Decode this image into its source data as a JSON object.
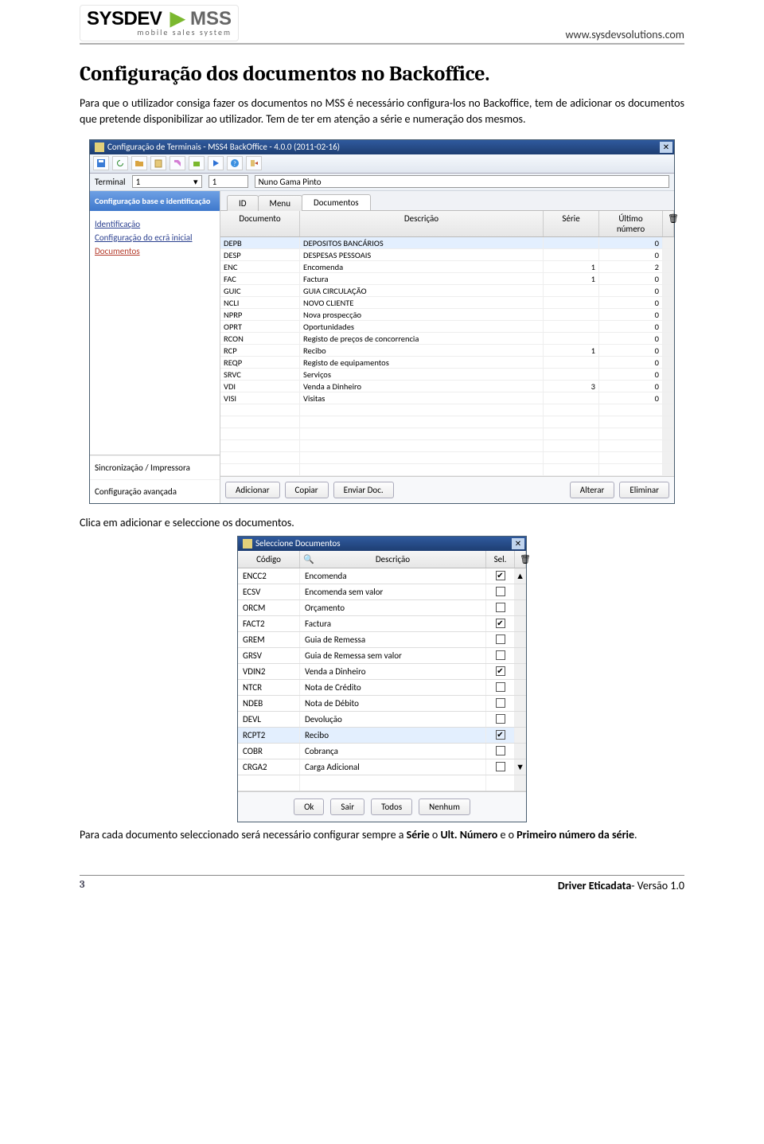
{
  "header": {
    "logo_main": "SYSDEV",
    "logo_accent": "MSS",
    "logo_sub": "mobile sales system",
    "site": "www.sysdevsolutions.com"
  },
  "title": "Configuração dos documentos no Backoffice.",
  "intro": "Para que o utilizador consiga fazer os documentos no MSS é necessário configura-los no Backoffice, tem de adicionar os documentos que pretende disponibilizar ao utilizador. Tem de ter em atenção a série e numeração dos mesmos.",
  "win1": {
    "title": "Configuração de Terminais - MSS4 BackOffice - 4.0.0 (2011-02-16)",
    "terminal_label": "Terminal",
    "terminal_id": "1",
    "terminal_code": "1",
    "terminal_name": "Nuno Gama Pinto",
    "side_head": "Configuração base e identificação",
    "side_links": {
      "ident": "Identificação",
      "ecra": "Configuração do ecrã inicial",
      "docs": "Documentos"
    },
    "side_sync": "Sincronização / Impressora",
    "side_adv": "Configuração avançada",
    "tabs": {
      "id": "ID",
      "menu": "Menu",
      "docs": "Documentos"
    },
    "cols": {
      "doc": "Documento",
      "desc": "Descrição",
      "serie": "Série",
      "ult": "Último número"
    },
    "rows": [
      {
        "doc": "DEPB",
        "desc": "DEPOSITOS BANCÁRIOS",
        "serie": "",
        "ult": "0",
        "sel": true
      },
      {
        "doc": "DESP",
        "desc": "DESPESAS PESSOAIS",
        "serie": "",
        "ult": "0"
      },
      {
        "doc": "ENC",
        "desc": "Encomenda",
        "serie": "1",
        "ult": "2"
      },
      {
        "doc": "FAC",
        "desc": "Factura",
        "serie": "1",
        "ult": "0"
      },
      {
        "doc": "GUIC",
        "desc": "GUIA CIRCULAÇÃO",
        "serie": "",
        "ult": "0"
      },
      {
        "doc": "NCLI",
        "desc": "NOVO CLIENTE",
        "serie": "",
        "ult": "0"
      },
      {
        "doc": "NPRP",
        "desc": "Nova prospecção",
        "serie": "",
        "ult": "0"
      },
      {
        "doc": "OPRT",
        "desc": "Oportunidades",
        "serie": "",
        "ult": "0"
      },
      {
        "doc": "RCON",
        "desc": "Registo de preços de concorrencia",
        "serie": "",
        "ult": "0"
      },
      {
        "doc": "RCP",
        "desc": "Recibo",
        "serie": "1",
        "ult": "0"
      },
      {
        "doc": "REQP",
        "desc": "Registo de equipamentos",
        "serie": "",
        "ult": "0"
      },
      {
        "doc": "SRVC",
        "desc": "Serviços",
        "serie": "",
        "ult": "0"
      },
      {
        "doc": "VDI",
        "desc": "Venda a Dinheiro",
        "serie": "3",
        "ult": "0"
      },
      {
        "doc": "VISI",
        "desc": "Visitas",
        "serie": "",
        "ult": "0"
      }
    ],
    "buttons": {
      "add": "Adicionar",
      "copy": "Copiar",
      "send": "Enviar Doc.",
      "edit": "Alterar",
      "del": "Eliminar"
    }
  },
  "caption1": "Clica em adicionar e seleccione os documentos.",
  "win2": {
    "title": "Seleccione Documentos",
    "cols": {
      "cod": "Código",
      "desc": "Descrição",
      "sel": "Sel."
    },
    "rows": [
      {
        "cod": "ENCC2",
        "desc": "Encomenda",
        "chk": true
      },
      {
        "cod": "ECSV",
        "desc": "Encomenda sem valor",
        "chk": false
      },
      {
        "cod": "ORCM",
        "desc": "Orçamento",
        "chk": false
      },
      {
        "cod": "FACT2",
        "desc": "Factura",
        "chk": true
      },
      {
        "cod": "GREM",
        "desc": "Guia de Remessa",
        "chk": false
      },
      {
        "cod": "GRSV",
        "desc": "Guia de Remessa sem valor",
        "chk": false
      },
      {
        "cod": "VDIN2",
        "desc": "Venda a Dinheiro",
        "chk": true
      },
      {
        "cod": "NTCR",
        "desc": "Nota de Crédito",
        "chk": false
      },
      {
        "cod": "NDEB",
        "desc": "Nota de Débito",
        "chk": false
      },
      {
        "cod": "DEVL",
        "desc": "Devolução",
        "chk": false
      },
      {
        "cod": "RCPT2",
        "desc": "Recibo",
        "chk": true,
        "sel": true
      },
      {
        "cod": "COBR",
        "desc": "Cobrança",
        "chk": false
      },
      {
        "cod": "CRGA2",
        "desc": "Carga Adicional",
        "chk": false
      }
    ],
    "buttons": {
      "ok": "Ok",
      "sair": "Sair",
      "todos": "Todos",
      "nenhum": "Nenhum"
    }
  },
  "para2_pre": "Para cada documento seleccionado será necessário configurar sempre a ",
  "para2_b1": "Série",
  "para2_mid": " o ",
  "para2_b2": "Ult. Número",
  "para2_mid2": " e o ",
  "para2_b3": "Primeiro número da série",
  "para2_end": ".",
  "footer": {
    "page": "3",
    "product": "Driver Eticadata",
    "ver": "- Versão 1.0"
  }
}
